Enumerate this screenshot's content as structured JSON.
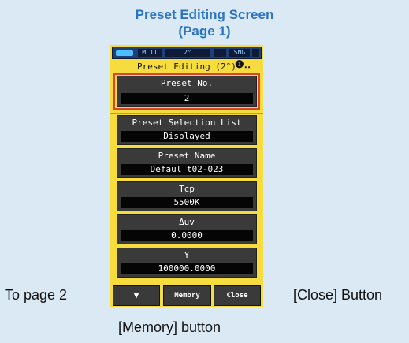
{
  "title": {
    "line1": "Preset Editing Screen",
    "line2": "(Page 1)"
  },
  "statusbar": {
    "mode": "M 11",
    "angle": "2°",
    "single": "SNG"
  },
  "screen_header": {
    "title": "Preset Editing (2°)",
    "info_icon": "info-icon"
  },
  "fields": [
    {
      "label": "Preset No.",
      "value": "2"
    },
    {
      "label": "Preset Selection List",
      "value": "Displayed"
    },
    {
      "label": "Preset Name",
      "value": "Defaul t02-023"
    },
    {
      "label": "Tcp",
      "value": "5500K"
    },
    {
      "label": "Δuv",
      "value": "0.0000"
    },
    {
      "label": "Y",
      "value": "100000.0000"
    }
  ],
  "buttons": {
    "down_icon": "▼",
    "memory": "Memory",
    "close": "Close"
  },
  "annotations": {
    "to_page2": "To page 2",
    "close_button": "[Close] Button",
    "memory_button": "[Memory] button"
  },
  "colors": {
    "highlight": "#d9442a",
    "title": "#2b73c2",
    "device_bg": "#f6dc3c"
  }
}
